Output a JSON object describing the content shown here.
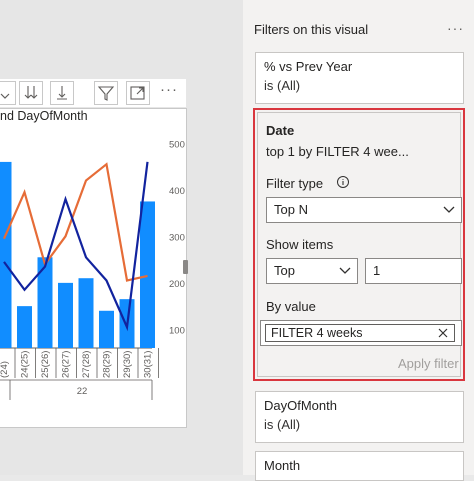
{
  "visual": {
    "title": "nd DayOfMonth",
    "toolbar": [
      "drill-down-icon",
      "expand-all-icon",
      "expand-next-level-icon",
      "filter-icon",
      "focus-mode-icon",
      "more-options-icon"
    ],
    "more_label": "···"
  },
  "chart_data": {
    "type": "bar",
    "categories": [
      "24(25)",
      "25(26)",
      "26(27)",
      "27(28)",
      "28(29)",
      "29(30)",
      "30(31)"
    ],
    "group_label": "22",
    "partial_leading_label": "(24)",
    "y2_ticks": [
      100,
      200,
      300,
      400,
      500
    ],
    "y2lim": [
      60,
      520
    ],
    "series": [
      {
        "values": [
          460,
          150,
          255,
          200,
          210,
          140,
          165,
          375
        ]
      },
      {
        "values": [
          295,
          395,
          240,
          300,
          420,
          455,
          205,
          215
        ]
      },
      {
        "values": [
          245,
          185,
          235,
          380,
          255,
          205,
          105,
          460
        ]
      }
    ],
    "colors": {
      "bar": "#118dff",
      "line_orange": "#e66c37",
      "line_navy": "#12239e",
      "axis": "#605e5c",
      "grid": "#c8c6c4"
    }
  },
  "pane": {
    "header": "Filters on this visual",
    "more_label": "···",
    "cards": [
      {
        "field": "% vs Prev Year",
        "state": "is (All)"
      },
      {
        "field": "DayOfMonth",
        "state": "is (All)"
      },
      {
        "field": "Month",
        "state": ""
      }
    ],
    "date_card": {
      "field": "Date",
      "summary": "top 1 by FILTER 4 wee...",
      "filter_type_label": "Filter type",
      "filter_type_value": "Top N",
      "show_items_label": "Show items",
      "show_items_direction": "Top",
      "show_items_count": "1",
      "by_value_label": "By value",
      "by_value_field": "FILTER 4 weeks",
      "apply_label": "Apply filter"
    }
  }
}
